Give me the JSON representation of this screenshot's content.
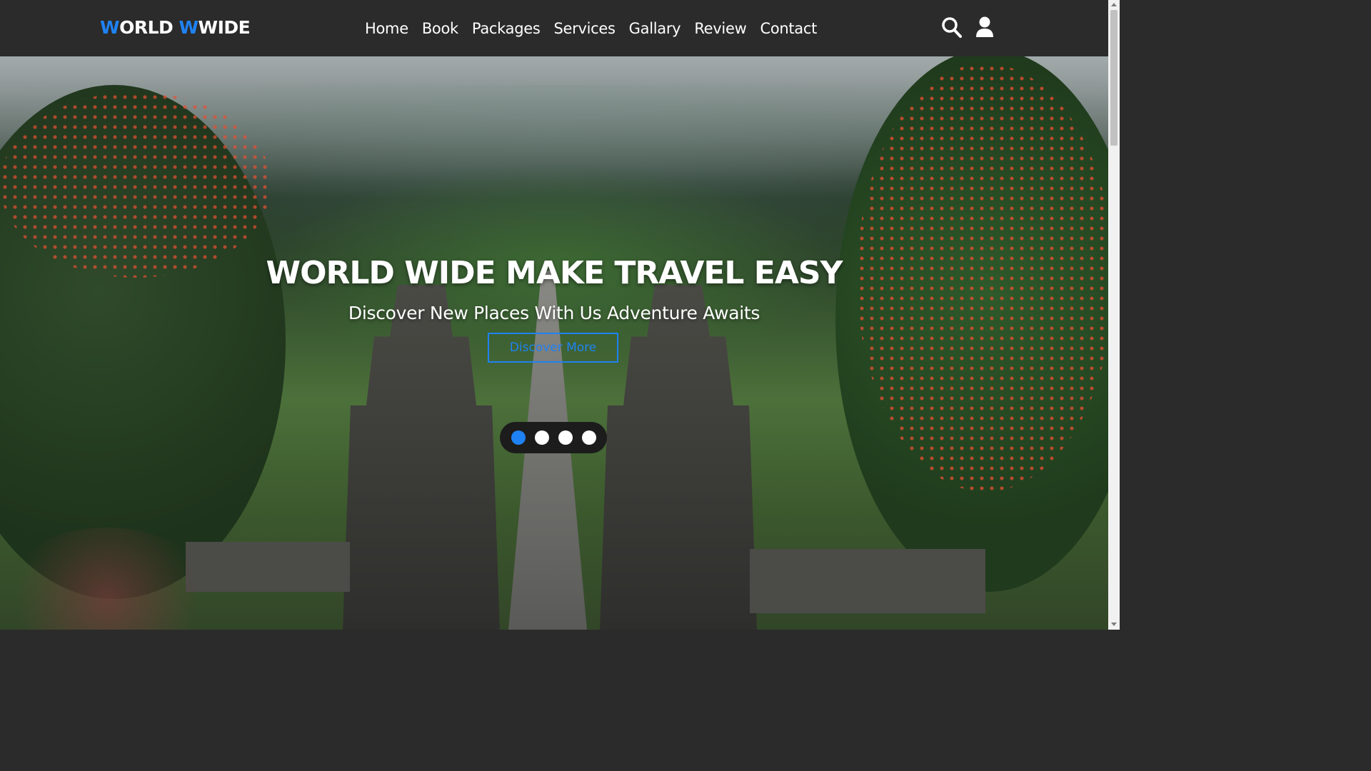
{
  "header": {
    "logo_prefix_accent": "W",
    "logo_prefix": "ORLD ",
    "logo_suffix_accent": "W",
    "logo_suffix": "WIDE",
    "nav": [
      "Home",
      "Book",
      "Packages",
      "Services",
      "Gallary",
      "Review",
      "Contact"
    ],
    "icons": [
      "search-icon",
      "user-icon"
    ]
  },
  "hero": {
    "title": "WORLD WIDE MAKE TRAVEL EASY",
    "subtitle": "Discover New Places With Us Adventure Awaits",
    "button_label": "Discover More",
    "slider_dots": 4,
    "active_dot": 1
  },
  "colors": {
    "accent": "#1f82f4",
    "navbar": "#2b2b2b"
  }
}
